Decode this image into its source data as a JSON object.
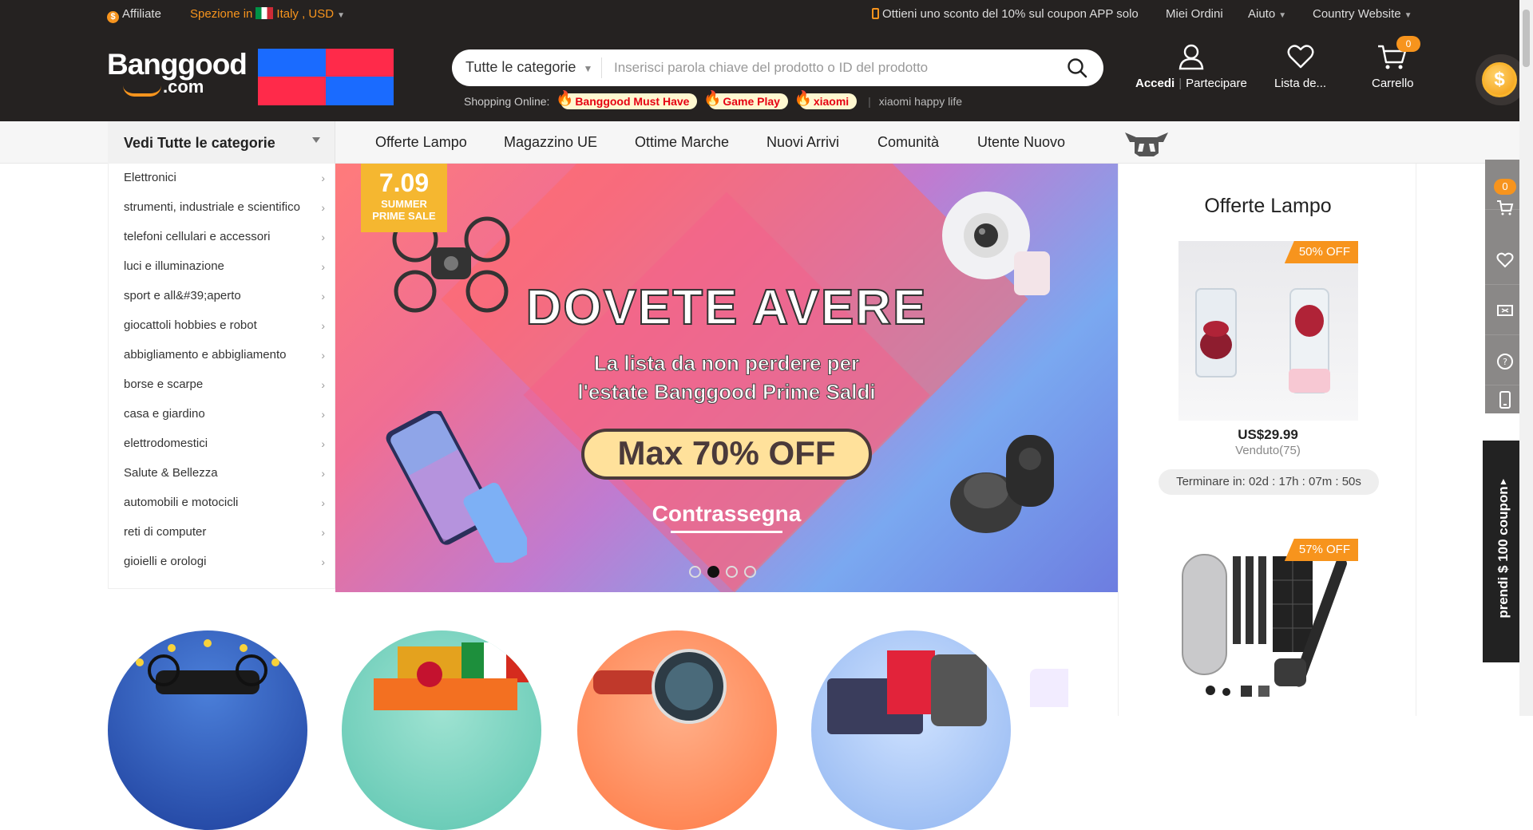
{
  "topbar": {
    "affiliate": "Affiliate",
    "ship_prefix": "Spezione in",
    "ship_country": "Italy",
    "currency": ", USD",
    "app_coupon": "Ottieni uno sconto del 10% sul coupon APP solo",
    "orders": "Miei Ordini",
    "help": "Aiuto",
    "country_website": "Country Website"
  },
  "header": {
    "logo_main": "Banggood",
    "logo_com": ".com",
    "search": {
      "category": "Tutte le categorie",
      "placeholder": "Inserisci parola chiave del prodotto o ID del prodotto"
    },
    "hot": {
      "label": "Shopping Online:",
      "tags": [
        "Banggood Must Have",
        "Game Play",
        "xiaomi"
      ],
      "plain": "xiaomi happy life"
    },
    "account": {
      "login": "Accedi",
      "join": "Partecipare"
    },
    "wishlist": "Lista de...",
    "cart": {
      "label": "Carrello",
      "count": "0"
    },
    "coin_symbol": "$"
  },
  "nav": {
    "all_categories": "Vedi Tutte le categorie",
    "items": [
      "Offerte Lampo",
      "Magazzino UE",
      "Ottime Marche",
      "Nuovi Arrivi",
      "Comunità",
      "Utente Nuovo"
    ]
  },
  "sidebar": {
    "items": [
      "Elettronici",
      "strumenti, industriale e scientifico",
      "telefoni cellulari e accessori",
      "luci e illuminazione",
      "sport e all&#39;aperto",
      "giocattoli hobbies e robot",
      "abbigliamento e abbigliamento",
      "borse e scarpe",
      "casa e giardino",
      "elettrodomestici",
      "Salute & Bellezza",
      "automobili e motocicli",
      "reti di computer",
      "gioielli e orologi"
    ]
  },
  "hero": {
    "badge_number": "7.09",
    "badge_line1": "SUMMER",
    "badge_line2": "PRIME SALE",
    "title": "DOVETE AVERE",
    "subtitle_line1": "La lista da non perdere per",
    "subtitle_line2": "l'estate Banggood Prime Saldi",
    "button": "Max 70% OFF",
    "link": "Contrassegna",
    "slides": 4,
    "active_slide": 2
  },
  "deals": {
    "title": "Offerte Lampo",
    "items": [
      {
        "off": "50% OFF",
        "price": "US$29.99",
        "sold": "Venduto(75)",
        "timer": "Terminare in: 02d : 17h : 07m : 50s"
      },
      {
        "off": "57% OFF"
      }
    ]
  },
  "float_bar": {
    "cart_count": "0"
  },
  "coupon_tab": "prendi $ 100 coupon"
}
